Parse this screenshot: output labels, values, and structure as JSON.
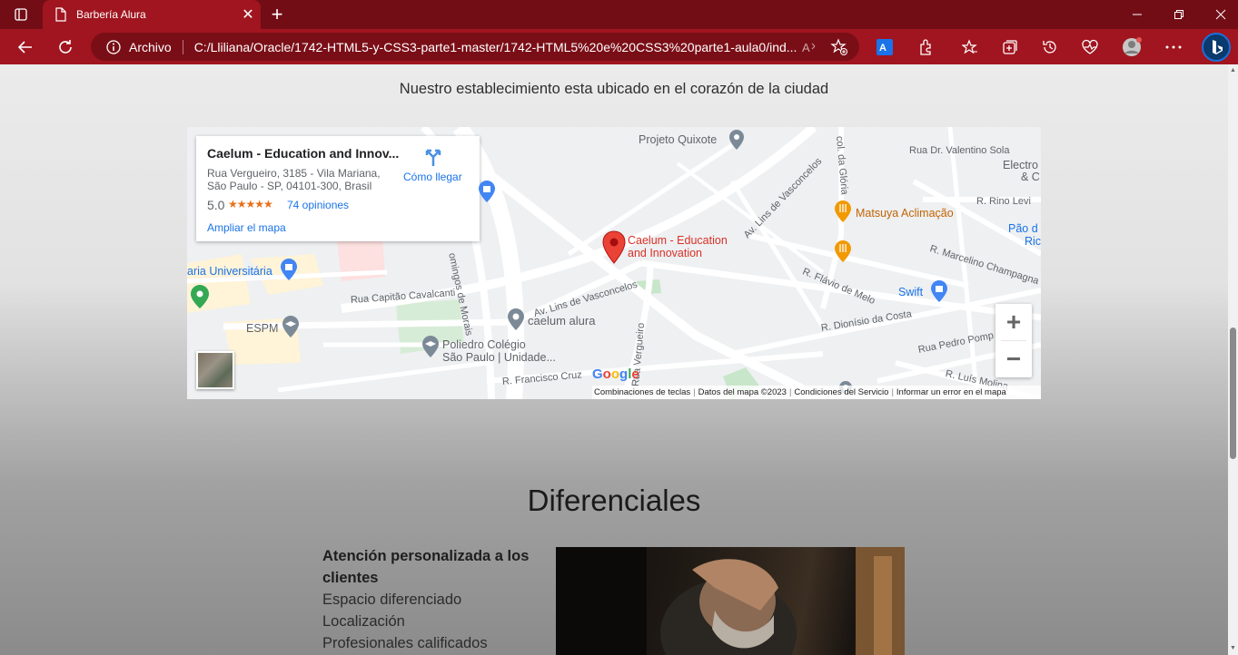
{
  "browser": {
    "tab_title": "Barbería Alura",
    "scheme_label": "Archivo",
    "url": "C:/Lliliana/Oracle/1742-HTML5-y-CSS3-parte1-master/1742-HTML5%20e%20CSS3%20parte1-aula0/ind..."
  },
  "page": {
    "subtitle": "Nuestro establecimiento esta ubicado en el corazón de la ciudad"
  },
  "map": {
    "card": {
      "place": "Caelum - Education and Innov...",
      "address_line1": "Rua Vergueiro, 3185 - Vila Mariana,",
      "address_line2": "São Paulo - SP, 04101-300, Brasil",
      "rating": "5.0",
      "stars": "★★★★★",
      "reviews": "74 opiniones",
      "directions": "Cómo llegar",
      "enlarge": "Ampliar el mapa"
    },
    "marker_label_line1": "Caelum - Education",
    "marker_label_line2": "and Innovation",
    "pois": {
      "projeto_quixote": "Projeto Quixote",
      "matsuya": "Matsuya Aclimação",
      "swift": "Swift",
      "caelum_alura": "caelum alura",
      "poliedro_line1": "Poliedro Colégio",
      "poliedro_line2": "São Paulo | Unidade...",
      "espm": "ESPM",
      "universitaria": "aria Universitária",
      "electro": "Electro",
      "electro2": "& C",
      "pao_de": "Pão d",
      "ric": "Ric"
    },
    "roads": {
      "valentino": "Rua Dr. Valentino Sola",
      "rino_levi": "R. Rino Levi",
      "marcelino": "R. Marcelino Champagna",
      "flavio": "R. Flávio de Melo",
      "dionisio": "R. Dionísio da Costa",
      "pedro_pomp": "Rua Pedro Pomp",
      "luis_molina": "R. Luís Molina",
      "lins_1": "Av. Lins de Vasconcelos",
      "lins_2": "Av. Lins de Vasconcelos",
      "capitao": "Rua Capitão Cavalcanti",
      "domingos": "omingos de Morais",
      "vergueiro": "Rua Vergueiro",
      "francisco": "R. Francisco Cruz",
      "gloria": "col. da Glória"
    },
    "google": "Google",
    "attribution": {
      "shortcuts": "Combinaciones de teclas",
      "data": "Datos del mapa ©2023",
      "terms": "Condiciones del Servicio",
      "report": "Informar un error en el mapa"
    },
    "zoom_in": "+",
    "zoom_out": "−"
  },
  "diferenciales": {
    "title": "Diferenciales",
    "items": [
      "Atención personalizada a los clientes",
      "Espacio diferenciado",
      "Localización",
      "Profesionales calificados"
    ]
  },
  "colors": {
    "titlebar": "#720d16",
    "toolbar": "#a0151f",
    "link": "#1a73e8",
    "marker": "#ea4335",
    "food": "#f29900",
    "shop": "#4285f4"
  }
}
